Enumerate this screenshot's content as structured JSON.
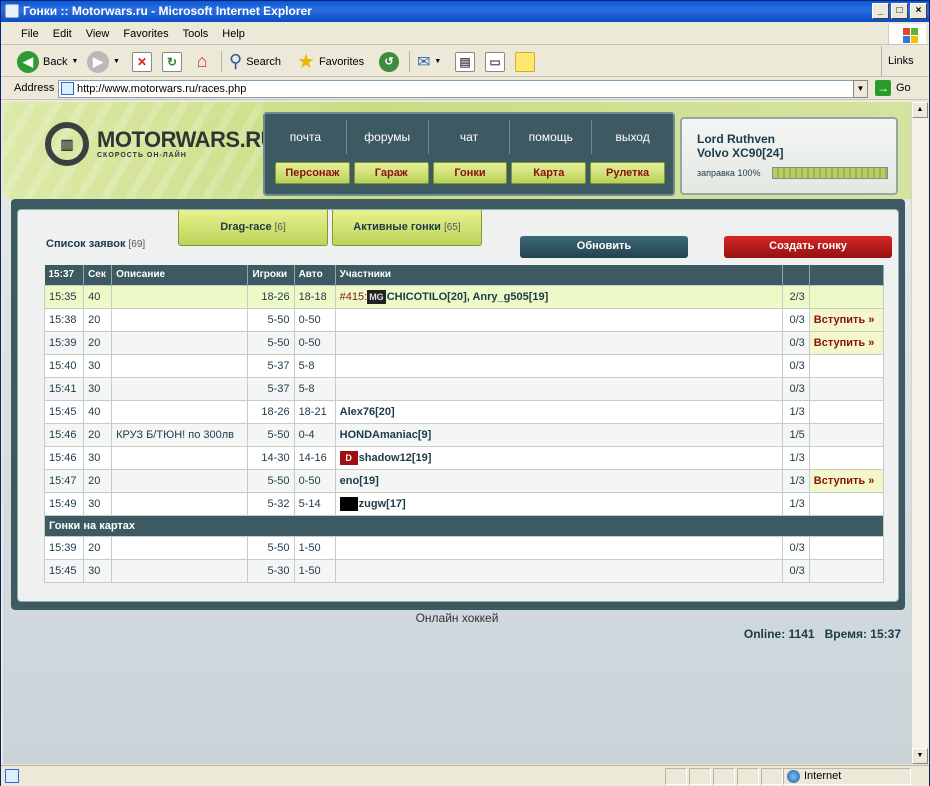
{
  "window": {
    "title": "Гонки :: Motorwars.ru - Microsoft Internet Explorer",
    "min": "_",
    "max": "□",
    "close": "×"
  },
  "menu": [
    "File",
    "Edit",
    "View",
    "Favorites",
    "Tools",
    "Help"
  ],
  "toolbar": {
    "back": "Back",
    "search": "Search",
    "favorites": "Favorites",
    "links": "Links"
  },
  "address": {
    "label": "Address",
    "url": "http://www.motorwars.ru/races.php",
    "go": "Go"
  },
  "site": {
    "logo_text": "MOTORWARS.RU",
    "logo_sub": "СКОРОСТЬ ОН-ЛАЙН",
    "nav_top": [
      "почта",
      "форумы",
      "чат",
      "помощь",
      "выход"
    ],
    "nav_bottom": [
      "Персонаж",
      "Гараж",
      "Гонки",
      "Карта",
      "Рулетка"
    ],
    "user": {
      "name": "Lord Ruthven",
      "car": "Volvo XC90[24]",
      "fuel": "заправка 100%"
    }
  },
  "races": {
    "list_label": "Список заявок",
    "list_count": "[69]",
    "tab_drag": "Drag-race",
    "tab_drag_count": "[6]",
    "tab_active": "Активные гонки",
    "tab_active_count": "[65]",
    "refresh": "Обновить",
    "create": "Создать гонку",
    "columns": [
      "15:37",
      "Сек",
      "Описание",
      "Игроки",
      "Авто",
      "Участники",
      "",
      ""
    ],
    "rows": [
      {
        "time": "15:35",
        "sec": "40",
        "desc": "",
        "players": "18-26",
        "auto": "18-18",
        "race_no": "#415:",
        "badge": "MG",
        "participants": "CHICOTILO[20], Anry_g505[19]",
        "count": "2/3",
        "action": ""
      },
      {
        "time": "15:38",
        "sec": "20",
        "desc": "",
        "players": "5-50",
        "auto": "0-50",
        "race_no": "",
        "badge": "",
        "participants": "",
        "count": "0/3",
        "action": "Вступить »"
      },
      {
        "time": "15:39",
        "sec": "20",
        "desc": "",
        "players": "5-50",
        "auto": "0-50",
        "race_no": "",
        "badge": "",
        "participants": "",
        "count": "0/3",
        "action": "Вступить »"
      },
      {
        "time": "15:40",
        "sec": "30",
        "desc": "",
        "players": "5-37",
        "auto": "5-8",
        "race_no": "",
        "badge": "",
        "participants": "",
        "count": "0/3",
        "action": ""
      },
      {
        "time": "15:41",
        "sec": "30",
        "desc": "",
        "players": "5-37",
        "auto": "5-8",
        "race_no": "",
        "badge": "",
        "participants": "",
        "count": "0/3",
        "action": ""
      },
      {
        "time": "15:45",
        "sec": "40",
        "desc": "",
        "players": "18-26",
        "auto": "18-21",
        "race_no": "",
        "badge": "",
        "participants": "Alex76[20]",
        "count": "1/3",
        "action": ""
      },
      {
        "time": "15:46",
        "sec": "20",
        "desc": "КРУЗ Б/ТЮН! по 300лв",
        "players": "5-50",
        "auto": "0-4",
        "race_no": "",
        "badge": "",
        "participants": "HONDAmaniac[9]",
        "count": "1/5",
        "action": ""
      },
      {
        "time": "15:46",
        "sec": "30",
        "desc": "",
        "players": "14-30",
        "auto": "14-16",
        "race_no": "",
        "badge": "D",
        "participants": "shadow12[19]",
        "count": "1/3",
        "action": ""
      },
      {
        "time": "15:47",
        "sec": "20",
        "desc": "",
        "players": "5-50",
        "auto": "0-50",
        "race_no": "",
        "badge": "",
        "participants": "eno[19]",
        "count": "1/3",
        "action": "Вступить »"
      },
      {
        "time": "15:49",
        "sec": "30",
        "desc": "",
        "players": "5-32",
        "auto": "5-14",
        "race_no": "",
        "badge": "■",
        "participants": "zugw[17]",
        "count": "1/3",
        "action": ""
      }
    ],
    "map_section": "Гонки на картах",
    "map_rows": [
      {
        "time": "15:39",
        "sec": "20",
        "desc": "",
        "players": "5-50",
        "auto": "1-50",
        "participants": "",
        "count": "0/3",
        "action": ""
      },
      {
        "time": "15:45",
        "sec": "30",
        "desc": "",
        "players": "5-30",
        "auto": "1-50",
        "participants": "",
        "count": "0/3",
        "action": ""
      }
    ]
  },
  "footer": {
    "hockey": "Онлайн хоккей",
    "online": "Online: 1141",
    "time": "Время: 15:37"
  },
  "status": {
    "zone": "Internet"
  },
  "colors": {
    "panel": "#3d5961",
    "accent_green": "#bcd45a",
    "button_red": "#b01818",
    "button_teal": "#2f5260"
  }
}
